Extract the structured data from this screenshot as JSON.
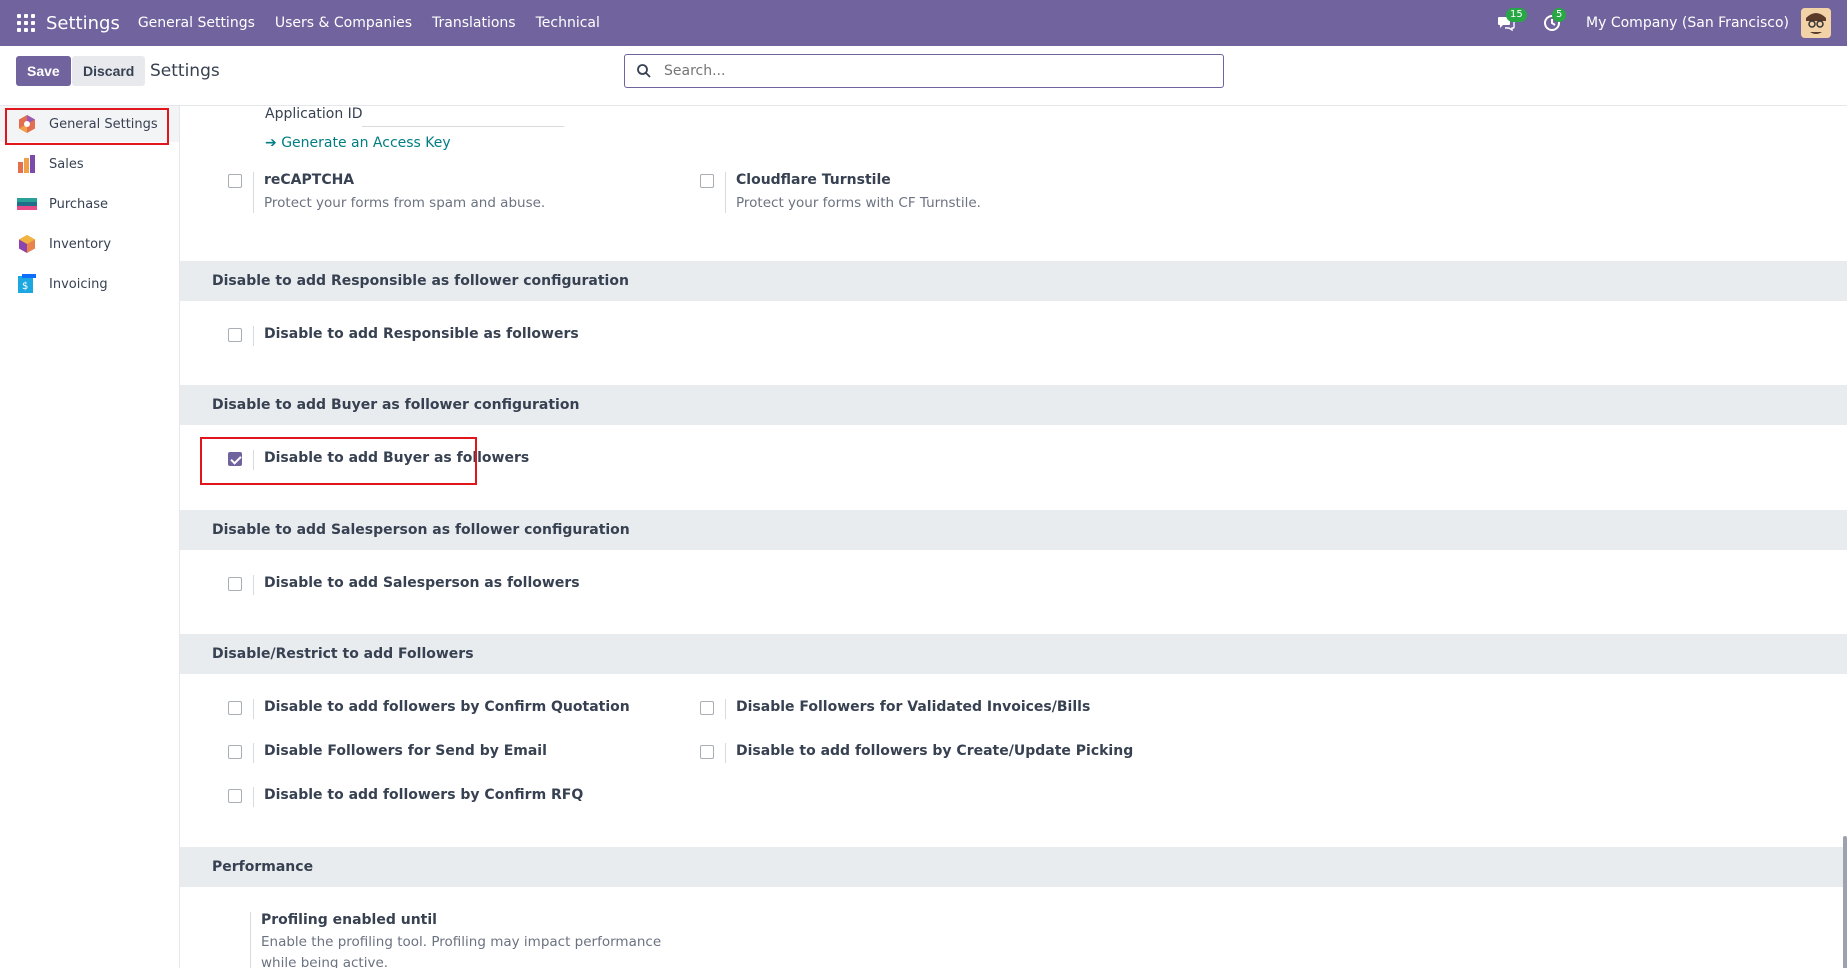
{
  "navbar": {
    "brand": "Settings",
    "menu": [
      "General Settings",
      "Users & Companies",
      "Translations",
      "Technical"
    ],
    "messages_count": "15",
    "activities_count": "5",
    "company": "My Company (San Francisco)"
  },
  "control": {
    "save_label": "Save",
    "discard_label": "Discard",
    "title": "Settings",
    "search_placeholder": "Search..."
  },
  "sidebar": {
    "items": [
      {
        "label": "General Settings",
        "icon": "settings-app-icon"
      },
      {
        "label": "Sales",
        "icon": "sales-app-icon"
      },
      {
        "label": "Purchase",
        "icon": "purchase-app-icon"
      },
      {
        "label": "Inventory",
        "icon": "inventory-app-icon"
      },
      {
        "label": "Invoicing",
        "icon": "invoicing-app-icon"
      }
    ]
  },
  "content": {
    "application_id_label": "Application ID",
    "generate_key_link": "Generate an Access Key",
    "recaptcha": {
      "label": "reCAPTCHA",
      "desc": "Protect your forms from spam and abuse."
    },
    "turnstile": {
      "label": "Cloudflare Turnstile",
      "desc": "Protect your forms with CF Turnstile."
    },
    "sections": [
      {
        "title": "Disable to add Responsible as follower configuration"
      },
      {
        "title": "Disable to add Buyer as follower configuration"
      },
      {
        "title": "Disable to add Salesperson as follower configuration"
      },
      {
        "title": "Disable/Restrict to add Followers"
      },
      {
        "title": "Performance"
      }
    ],
    "responsible_label": "Disable to add Responsible as followers",
    "buyer_label": "Disable to add Buyer as followers",
    "salesperson_label": "Disable to add Salesperson as followers",
    "followers": {
      "confirm_quotation": "Disable to add followers by Confirm Quotation",
      "validated_invoices": "Disable Followers for Validated Invoices/Bills",
      "send_email": "Disable Followers for Send by Email",
      "create_update_picking": "Disable to add followers by Create/Update Picking",
      "confirm_rfq": "Disable to add followers by Confirm RFQ"
    },
    "profiling": {
      "label": "Profiling enabled until",
      "desc_line1": "Enable the profiling tool. Profiling may impact performance",
      "desc_line2": "while being active."
    }
  },
  "colors": {
    "brand": "#71639e",
    "highlight": "#e0161c",
    "link": "#017e84"
  }
}
